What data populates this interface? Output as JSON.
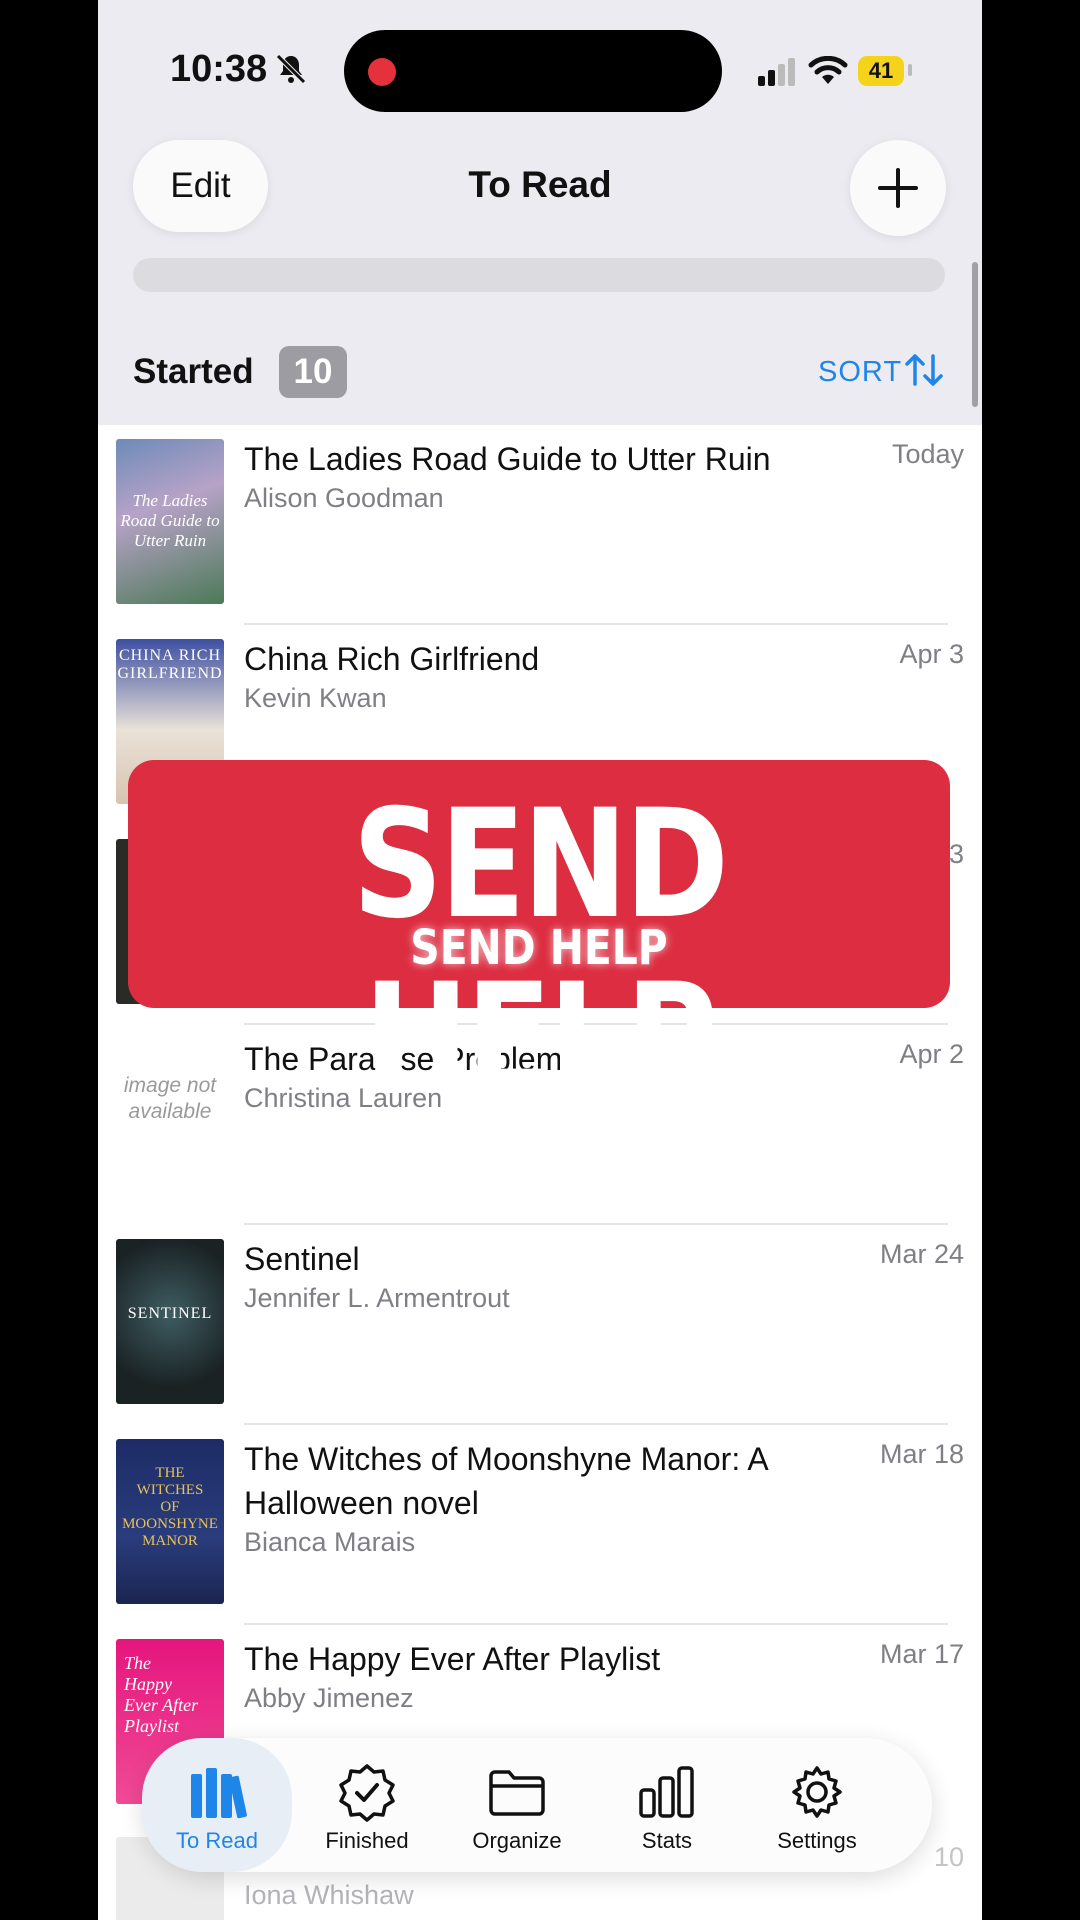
{
  "status_bar": {
    "time": "10:38",
    "battery": "41"
  },
  "header": {
    "edit_label": "Edit",
    "title": "To Read",
    "add_label": "+"
  },
  "section": {
    "title": "Started",
    "count": "10",
    "sort_label": "SORT"
  },
  "books": [
    {
      "title": "The Ladies Road Guide to Utter Ruin",
      "author": "Alison Goodman",
      "date": "Today"
    },
    {
      "title": "China Rich Girlfriend",
      "author": "Kevin Kwan",
      "date": "Apr 3"
    },
    {
      "title": "The Paradise Problem",
      "author": "Christina Lauren",
      "date": "Apr 2"
    },
    {
      "title": "Sentinel",
      "author": "Jennifer L. Armentrout",
      "date": "Mar 24"
    },
    {
      "title": "The Witches of Moonshyne Manor: A Halloween novel",
      "author": "Bianca Marais",
      "date": "Mar 18"
    },
    {
      "title": "The Happy Ever After Playlist",
      "author": "Abby Jimenez",
      "date": "Mar 17"
    }
  ],
  "peek_row": {
    "author": "Iona Whishaw",
    "date": "10"
  },
  "hidden_date_fragment": "3",
  "cover_placeholder": "image not available",
  "banner": {
    "main": "SEND HELP",
    "sub": "SEND HELP"
  },
  "tabs": [
    {
      "label": "To Read",
      "icon": "books-icon",
      "active": true
    },
    {
      "label": "Finished",
      "icon": "checkmark-seal-icon",
      "active": false
    },
    {
      "label": "Organize",
      "icon": "folder-icon",
      "active": false
    },
    {
      "label": "Stats",
      "icon": "bar-chart-icon",
      "active": false
    },
    {
      "label": "Settings",
      "icon": "gear-icon",
      "active": false
    }
  ],
  "colors": {
    "accent": "#1e86e8",
    "banner": "#dc2d41",
    "badge": "#9c9ca2"
  }
}
